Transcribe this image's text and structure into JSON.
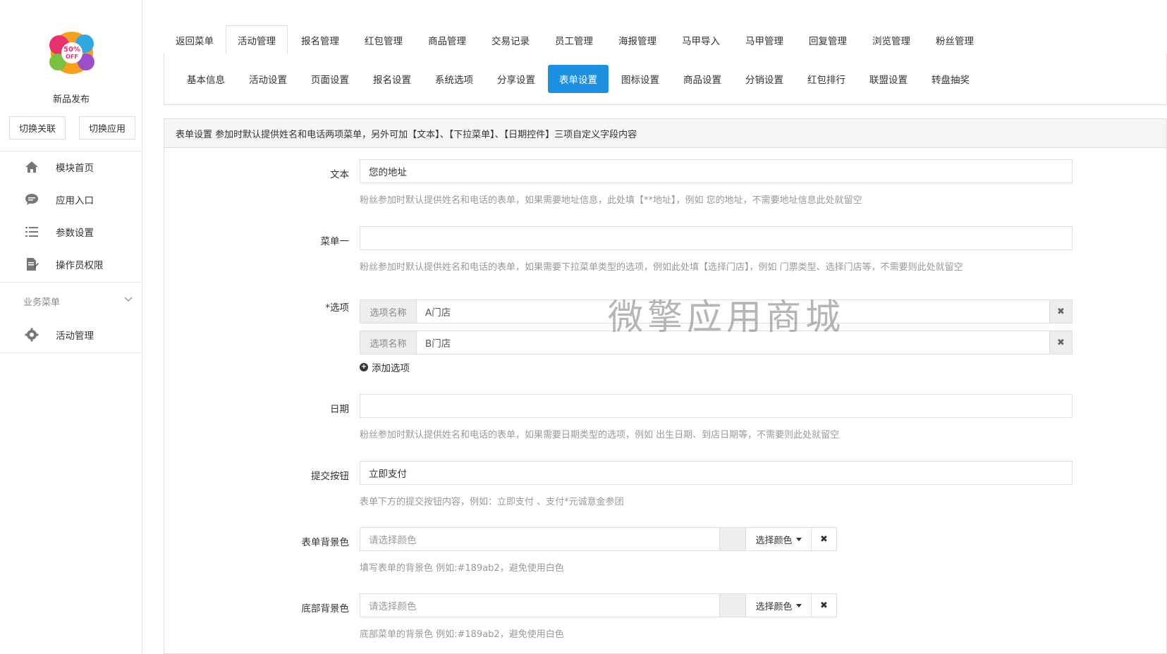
{
  "sidebar": {
    "app_name": "新品发布",
    "switch_relation": "切换关联",
    "switch_app": "切换应用",
    "nav": [
      {
        "label": "模块首页",
        "icon": "home-icon"
      },
      {
        "label": "应用入口",
        "icon": "chat-bubble-icon"
      },
      {
        "label": "参数设置",
        "icon": "list-icon"
      },
      {
        "label": "操作员权限",
        "icon": "edit-doc-icon"
      }
    ],
    "section_title": "业务菜单",
    "section_items": [
      {
        "label": "活动管理",
        "icon": "gear-icon"
      }
    ]
  },
  "top_tabs": [
    "返回菜单",
    "活动管理",
    "报名管理",
    "红包管理",
    "商品管理",
    "交易记录",
    "员工管理",
    "海报管理",
    "马甲导入",
    "马甲管理",
    "回复管理",
    "浏览管理",
    "粉丝管理"
  ],
  "top_active": 1,
  "sub_tabs": [
    "基本信息",
    "活动设置",
    "页面设置",
    "报名设置",
    "系统选项",
    "分享设置",
    "表单设置",
    "图标设置",
    "商品设置",
    "分销设置",
    "红包排行",
    "联盟设置",
    "转盘抽奖"
  ],
  "sub_active": 6,
  "panel": {
    "heading": "表单设置 参加时默认提供姓名和电话两项菜单，另外可加【文本】、【下拉菜单】、【日期控件】三项自定义字段内容",
    "text_label": "文本",
    "text_value": "您的地址",
    "text_help": "粉丝参加时默认提供姓名和电话的表单，如果需要地址信息，此处填【**地址】，例如 您的地址，不需要地址信息此处就留空",
    "menu_label": "菜单一",
    "menu_value": "",
    "menu_help": "粉丝参加时默认提供姓名和电话的表单，如果需要下拉菜单类型的选项，例如此处填【选择门店】，例如 门票类型、选择门店等，不需要则此处就留空",
    "options_label": "*选项",
    "option_addon": "选项名称",
    "options": [
      "A门店",
      "B门店"
    ],
    "option_delete": "✖",
    "add_option": "添加选项",
    "date_label": "日期",
    "date_value": "",
    "date_help": "粉丝参加时默认提供姓名和电话的表单，如果需要日期类型的选项，例如 出生日期、到店日期等，不需要则此处就留空",
    "submit_label": "提交按钮",
    "submit_value": "立即支付",
    "submit_help": "表单下方的提交按钮内容，例如：立即支付 、支付*元诚意金参团",
    "form_bg_label": "表单背景色",
    "form_bg_placeholder": "请选择颜色",
    "form_bg_help": "填写表单的背景色 例如:#189ab2，避免使用白色",
    "bottom_bg_label": "底部背景色",
    "bottom_bg_placeholder": "请选择颜色",
    "bottom_bg_help": "底部菜单的背景色 例如:#189ab2，避免使用白色",
    "choose_color": "选择颜色",
    "clear": "✖"
  },
  "watermark": "微擎应用商城",
  "colors": {
    "accent": "#1e90e0"
  }
}
